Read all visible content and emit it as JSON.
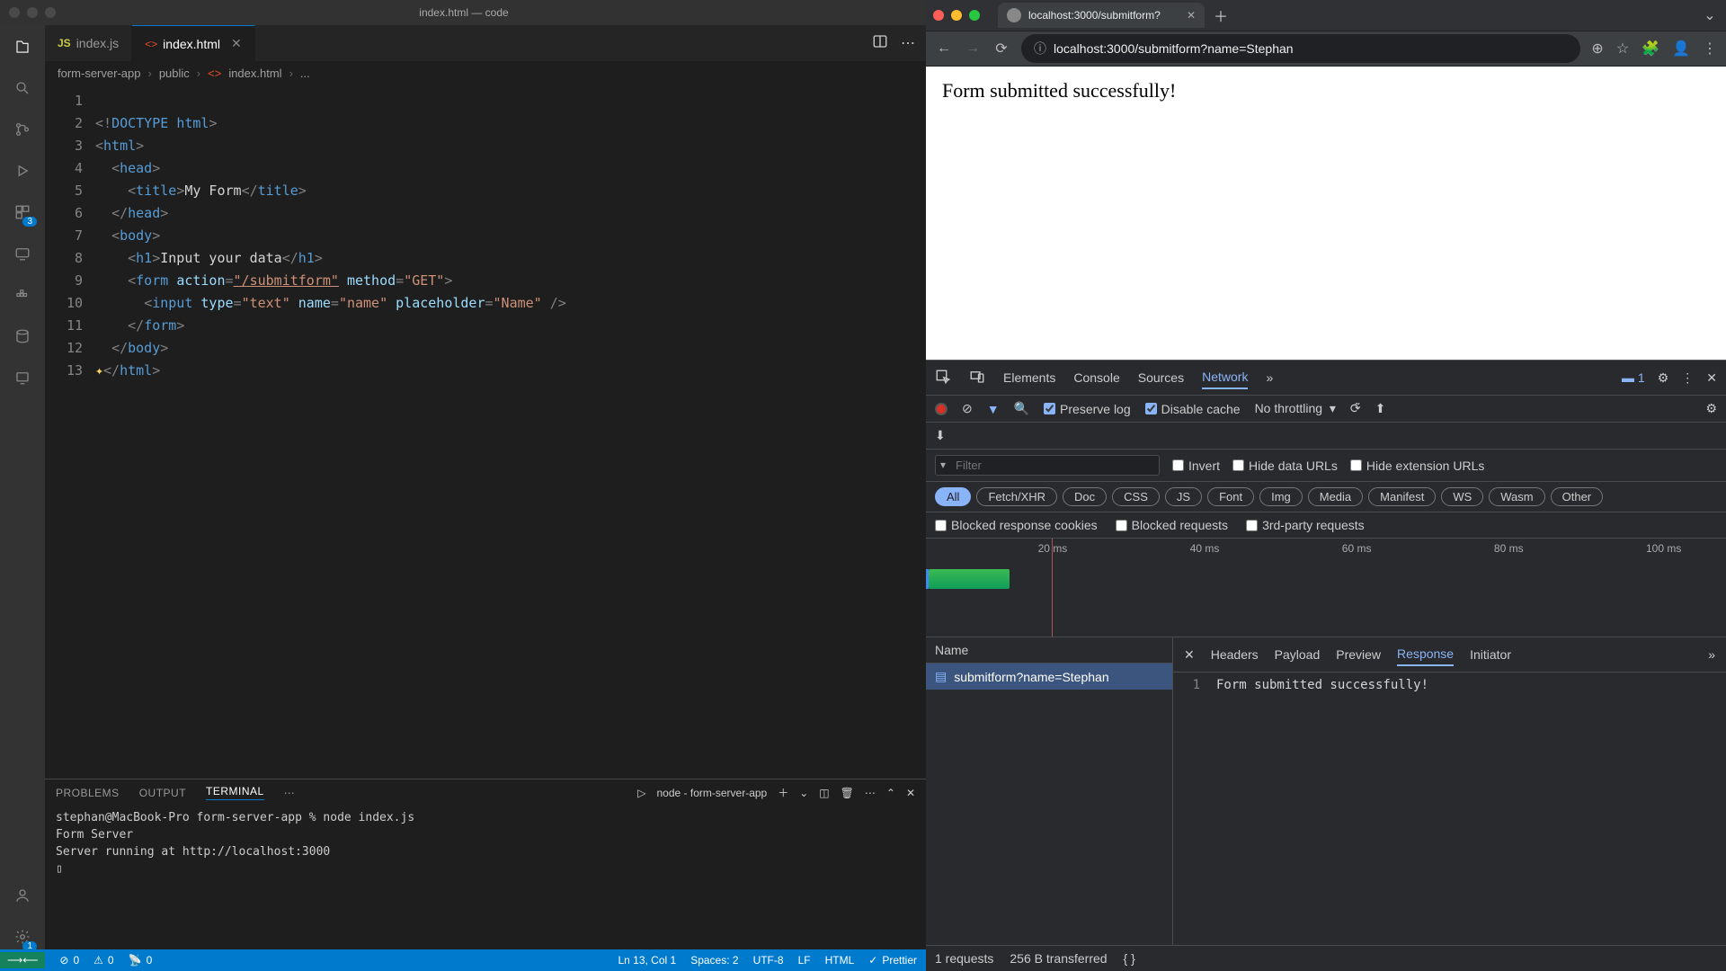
{
  "vscode": {
    "title": "index.html — code",
    "tabs": [
      {
        "label": "index.js",
        "active": false,
        "icon": "JS"
      },
      {
        "label": "index.html",
        "active": true,
        "icon": "<>"
      }
    ],
    "breadcrumb": {
      "p0": "form-server-app",
      "p1": "public",
      "p2": "index.html",
      "p3": "..."
    },
    "activity_badges": {
      "ext": "3",
      "settings": "1"
    },
    "gutter": [
      "1",
      "2",
      "3",
      "4",
      "5",
      "6",
      "7",
      "8",
      "9",
      "10",
      "11",
      "12",
      "13"
    ],
    "code_plain": {
      "l1_doctype": "DOCTYPE",
      "l1_html": "html",
      "l2": "html",
      "l3": "head",
      "l4_open": "title",
      "l4_text": "My Form",
      "l4_close": "title",
      "l5": "head",
      "l6": "body",
      "l7_open": "h1",
      "l7_text": "Input your data",
      "l7_close": "h1",
      "l8_tag": "form",
      "l8_a1": "action",
      "l8_v1": "\"/submitform\"",
      "l8_a2": "method",
      "l8_v2": "\"GET\"",
      "l9_tag": "input",
      "l9_a1": "type",
      "l9_v1": "\"text\"",
      "l9_a2": "name",
      "l9_v2": "\"name\"",
      "l9_a3": "placeholder",
      "l9_v3": "\"Name\"",
      "l10": "form",
      "l11": "body",
      "l12": "html"
    },
    "panel": {
      "tabs": {
        "problems": "PROBLEMS",
        "output": "OUTPUT",
        "terminal": "TERMINAL"
      },
      "shell_label": "node - form-server-app",
      "terminal_content": "stephan@MacBook-Pro form-server-app % node index.js\nForm Server\nServer running at http://localhost:3000\n▯"
    },
    "status": {
      "errors": "0",
      "warnings": "0",
      "ports": "0",
      "ln_col": "Ln 13, Col 1",
      "spaces": "Spaces: 2",
      "encoding": "UTF-8",
      "eol": "LF",
      "lang": "HTML",
      "prettier": "Prettier"
    }
  },
  "browser": {
    "tab_title": "localhost:3000/submitform?",
    "url": "localhost:3000/submitform?name=Stephan",
    "page_text": "Form submitted successfully!"
  },
  "devtools": {
    "tabs": {
      "elements": "Elements",
      "console": "Console",
      "sources": "Sources",
      "network": "Network"
    },
    "issue_count": "1",
    "toolbar": {
      "preserve": "Preserve log",
      "disable": "Disable cache",
      "throttle": "No throttling"
    },
    "filter_placeholder": "Filter",
    "filter_checks": {
      "invert": "Invert",
      "hidedata": "Hide data URLs",
      "hideext": "Hide extension URLs"
    },
    "types": [
      "All",
      "Fetch/XHR",
      "Doc",
      "CSS",
      "JS",
      "Font",
      "Img",
      "Media",
      "Manifest",
      "WS",
      "Wasm",
      "Other"
    ],
    "blocks": {
      "cookies": "Blocked response cookies",
      "req": "Blocked requests",
      "third": "3rd-party requests"
    },
    "timeline_ticks": [
      "20 ms",
      "40 ms",
      "60 ms",
      "80 ms",
      "100 ms"
    ],
    "req_header": "Name",
    "request_name": "submitform?name=Stephan",
    "detail_tabs": {
      "headers": "Headers",
      "payload": "Payload",
      "preview": "Preview",
      "response": "Response",
      "initiator": "Initiator"
    },
    "response_line_no": "1",
    "response_body": "Form submitted successfully!",
    "footer": {
      "req": "1 requests",
      "xfer": "256 B transferred"
    }
  }
}
